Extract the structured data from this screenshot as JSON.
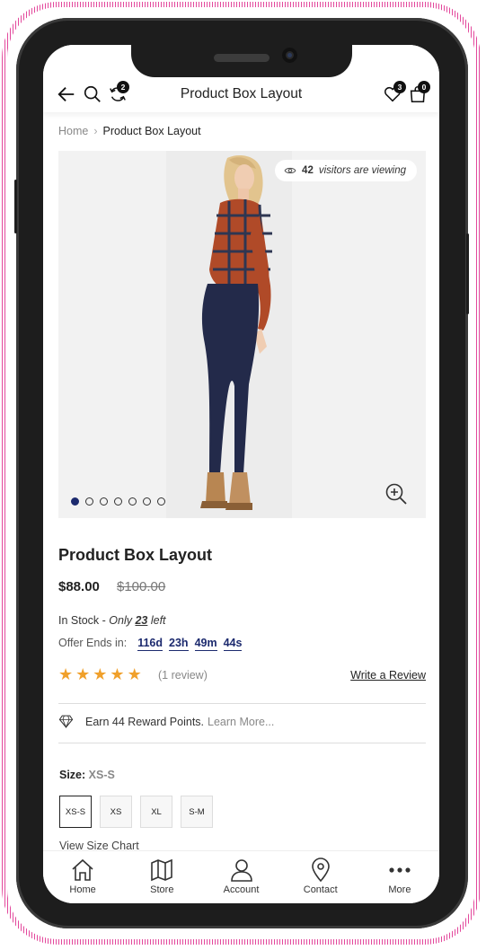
{
  "header": {
    "title": "Product Box Layout",
    "compare_count": "2",
    "wishlist_count": "3",
    "cart_count": "0"
  },
  "breadcrumb": {
    "home": "Home",
    "current": "Product Box Layout"
  },
  "gallery": {
    "visitors_count": "42",
    "visitors_text": "visitors are viewing",
    "slide_count": 7,
    "active_slide": 1
  },
  "product": {
    "title": "Product Box Layout",
    "price": "$88.00",
    "old_price": "$100.00",
    "stock_label": "In Stock",
    "stock_dash": " - ",
    "stock_only": "Only",
    "stock_qty": "23",
    "stock_left": "left",
    "offer_label": "Offer Ends in:",
    "offer_days": "116d",
    "offer_hours": "23h",
    "offer_minutes": "49m",
    "offer_seconds": "44s",
    "rating": 5,
    "review_count": "(1 review)",
    "write_review": "Write a Review",
    "reward_text": "Earn 44 Reward Points.",
    "reward_link": "Learn More...",
    "size_label": "Size:",
    "size_value": "XS-S",
    "sizes": [
      "XS-S",
      "XS",
      "XL",
      "S-M"
    ],
    "selected_size": "XS-S",
    "size_chart": "View Size Chart"
  },
  "bottom_nav": [
    {
      "label": "Home",
      "icon": "home-icon"
    },
    {
      "label": "Store",
      "icon": "map-icon"
    },
    {
      "label": "Account",
      "icon": "user-icon"
    },
    {
      "label": "Contact",
      "icon": "location-pin-icon"
    },
    {
      "label": "More",
      "icon": "more-dots-icon"
    }
  ],
  "colors": {
    "accent": "#1c2a6e",
    "star": "#f0a02b",
    "frame_pink": "#e3489c"
  }
}
